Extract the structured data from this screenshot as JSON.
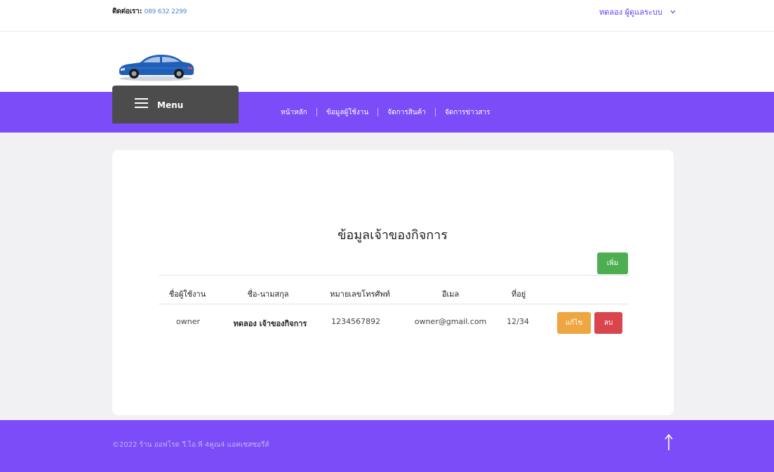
{
  "header": {
    "contact_label": "ติดต่อเรา:",
    "contact_phone": "089 632 2299",
    "user_menu": "ทดลอง ผู้ดูแลระบบ"
  },
  "logo": {
    "icon": "car-logo-icon"
  },
  "nav": {
    "menu_label": "Menu",
    "links": [
      "หน้าหลัก",
      "ข้อมูลผู้ใช้งาน",
      "จัดการสินค้า",
      "จัดการข่าวสาร"
    ]
  },
  "main": {
    "title": "ข้อมูลเจ้าของกิจการ",
    "add_button": "เพิ่ม",
    "table": {
      "headers": [
        "ชื่อผู้ใช้งาน",
        "ชื่อ-นามสกุล",
        "หมายเลขโทรศัพท์",
        "อีเมล",
        "ที่อยู่"
      ],
      "rows": [
        {
          "username": "owner",
          "fullname": "ทดลอง เจ้าของกิจการ",
          "phone": "1234567892",
          "email": "owner@gmail.com",
          "address": "12/34",
          "edit_label": "แก้ไข",
          "delete_label": "ลบ"
        }
      ]
    }
  },
  "footer": {
    "copyright": "©2022 ร้าน ออฟโรด วี.ไอ.พี 4คูณ4 แอคเซสซอรี่ส์",
    "to_top_icon": "arrow-up-icon"
  },
  "colors": {
    "brand": "#7b4cf7",
    "menu_box": "#4c4c4c",
    "add": "#4cae4f",
    "edit": "#eea542",
    "delete": "#d9444d"
  }
}
